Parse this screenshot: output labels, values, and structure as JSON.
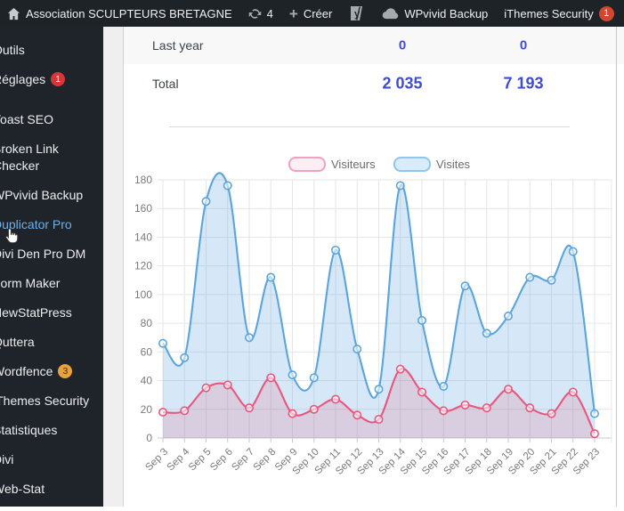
{
  "admin_bar": {
    "site_name": "Association SCULPTEURS BRETAGNE",
    "updates_count": "4",
    "new_label": "Créer",
    "wpvivid_label": "WPvivid Backup",
    "ithemes_label": "iThemes Security",
    "ithemes_badge": "1"
  },
  "sidebar": {
    "items": [
      {
        "label": "Outils"
      },
      {
        "label": "Réglages",
        "badge": "1",
        "badge_bg": "#d63638",
        "badge_fg": "#ffffff"
      },
      {
        "label": "Yoast SEO",
        "separated": true
      },
      {
        "label": "Broken Link Checker"
      },
      {
        "label": "WPvivid Backup"
      },
      {
        "label": "Duplicator Pro",
        "active": true
      },
      {
        "label": "Divi Den Pro DM"
      },
      {
        "label": "Form Maker"
      },
      {
        "label": "NewStatPress"
      },
      {
        "label": "Quttera"
      },
      {
        "label": "Wordfence",
        "badge": "3",
        "badge_bg": "#e8a33d",
        "badge_fg": "#4a3200"
      },
      {
        "label": "iThemes Security"
      },
      {
        "label": "Statistiques"
      },
      {
        "label": "Divi"
      },
      {
        "label": "Web-Stat"
      }
    ],
    "active_color": "#72aee6"
  },
  "stats_table": {
    "value_color": "#3d4bd7",
    "rows": [
      {
        "label": "Last year",
        "visitors": "0",
        "visits": "0"
      },
      {
        "label": "Total",
        "visitors": "2 035",
        "visits": "7 193"
      }
    ]
  },
  "chart_data": {
    "type": "area",
    "title": "",
    "xlabel": "",
    "ylabel": "",
    "ylim": [
      0,
      180
    ],
    "ytick_step": 20,
    "grid": true,
    "legend_position": "top",
    "x": [
      "Sep 3",
      "Sep 4",
      "Sep 5",
      "Sep 6",
      "Sep 7",
      "Sep 8",
      "Sep 9",
      "Sep 10",
      "Sep 11",
      "Sep 12",
      "Sep 13",
      "Sep 14",
      "Sep 15",
      "Sep 16",
      "Sep 17",
      "Sep 18",
      "Sep 19",
      "Sep 20",
      "Sep 21",
      "Sep 22",
      "Sep 23"
    ],
    "series": [
      {
        "name": "Visiteurs",
        "color": "#e9577c",
        "fill_opacity": 0.18,
        "legend_border": "#f2a0c0",
        "legend_fill": "#fdeef4",
        "values": [
          18,
          19,
          35,
          37,
          21,
          42,
          17,
          20,
          27,
          16,
          13,
          48,
          32,
          19,
          23,
          21,
          34,
          21,
          17,
          32,
          3
        ]
      },
      {
        "name": "Visites",
        "color": "#5aa5de",
        "fill_opacity": 0.25,
        "legend_border": "#8ec6ec",
        "legend_fill": "#daecf9",
        "values": [
          66,
          56,
          165,
          176,
          70,
          112,
          44,
          42,
          131,
          62,
          34,
          176,
          82,
          36,
          106,
          73,
          85,
          112,
          110,
          130,
          17
        ]
      }
    ]
  }
}
